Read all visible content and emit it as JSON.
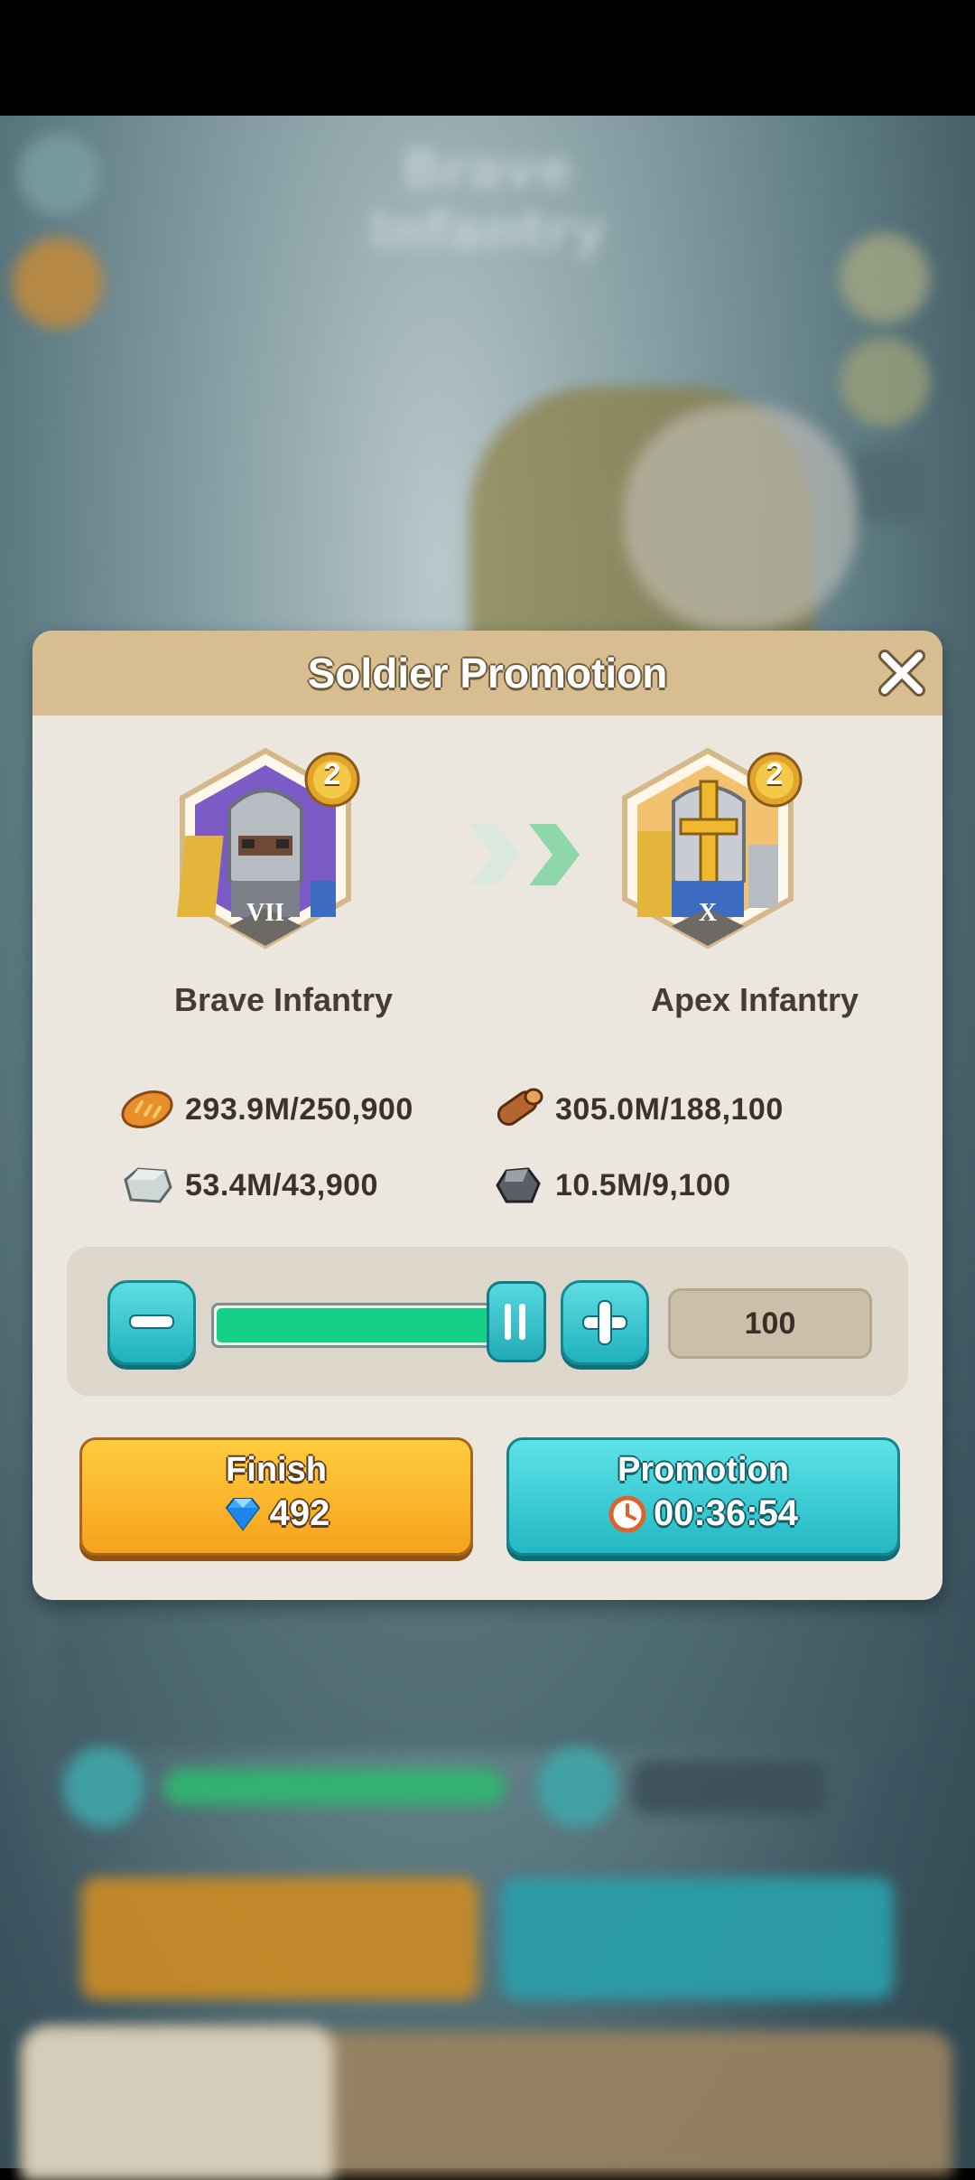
{
  "background": {
    "title": "Brave Infantry"
  },
  "dialog": {
    "title": "Soldier Promotion",
    "from_unit": {
      "name": "Brave Infantry",
      "tier": "VII",
      "rank": "2"
    },
    "to_unit": {
      "name": "Apex Infantry",
      "tier": "X",
      "rank": "2"
    },
    "resources": [
      {
        "icon": "bread-icon",
        "text": "293.9M/250,900"
      },
      {
        "icon": "wood-log-icon",
        "text": "305.0M/188,100"
      },
      {
        "icon": "stone-icon",
        "text": "53.4M/43,900"
      },
      {
        "icon": "iron-ore-icon",
        "text": "10.5M/9,100"
      }
    ],
    "slider": {
      "fill_fraction": 1.0,
      "quantity": "100"
    },
    "finish_button": {
      "label": "Finish",
      "cost": "492",
      "icon": "diamond-icon"
    },
    "promotion_button": {
      "label": "Promotion",
      "time": "00:36:54",
      "icon": "clock-icon"
    }
  },
  "colors": {
    "header": "#d8bd91",
    "panel": "#ebe7df",
    "finish": "#f5a21c",
    "promotion": "#23b8c3",
    "slider_fill": "#15d187"
  }
}
